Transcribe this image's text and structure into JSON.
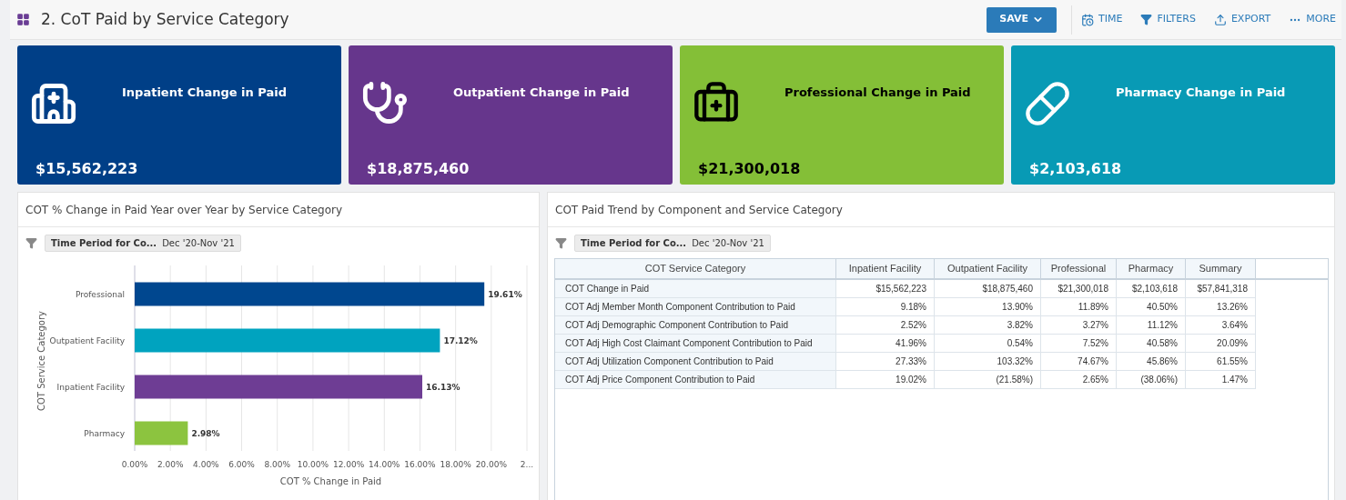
{
  "header": {
    "title": "2. CoT Paid by Service Category",
    "save_button": "SAVE",
    "toolbar": [
      {
        "label": "TIME",
        "kind": "time"
      },
      {
        "label": "FILTERS",
        "kind": "filters"
      },
      {
        "label": "EXPORT",
        "kind": "export"
      },
      {
        "label": "MORE",
        "kind": "more"
      }
    ]
  },
  "tiles": [
    {
      "title": "Inpatient Change in Paid",
      "value": "$15,562,223",
      "color": "#003f87"
    },
    {
      "title": "Outpatient Change in Paid",
      "value": "$18,875,460",
      "color": "#66368c"
    },
    {
      "title": "Professional Change in Paid",
      "value": "$21,300,018",
      "color": "#84bf37"
    },
    {
      "title": "Pharmacy Change in Paid",
      "value": "$2,103,618",
      "color": "#089ab5"
    }
  ],
  "left_panel": {
    "title": "COT % Change in Paid Year over Year by Service Category",
    "filter": {
      "label": "Time Period for Co...",
      "value": "Dec '20-Nov '21"
    },
    "chart_data": {
      "type": "bar",
      "orientation": "horizontal",
      "xlabel": "COT % Change in Paid",
      "ylabel": "COT Service Category",
      "categories": [
        "Professional",
        "Outpatient Facility",
        "Inpatient Facility",
        "Pharmacy"
      ],
      "series": [
        {
          "values": [
            19.61,
            17.12,
            16.13,
            2.98
          ]
        }
      ],
      "grid": true,
      "colors": [
        "#00478f",
        "#00a3bf",
        "#6e3d94",
        "#8cc43f"
      ],
      "value_labels": [
        "19.61%",
        "17.12%",
        "16.13%",
        "2.98%"
      ],
      "xlim": [
        0,
        22
      ],
      "xticks": [
        {
          "value": 0,
          "label": "0.00%"
        },
        {
          "value": 2,
          "label": "2.00%"
        },
        {
          "value": 4,
          "label": "4.00%"
        },
        {
          "value": 6,
          "label": "6.00%"
        },
        {
          "value": 8,
          "label": "8.00%"
        },
        {
          "value": 10,
          "label": "10.00%"
        },
        {
          "value": 12,
          "label": "12.00%"
        },
        {
          "value": 14,
          "label": "14.00%"
        },
        {
          "value": 16,
          "label": "16.00%"
        },
        {
          "value": 18,
          "label": "18.00%"
        },
        {
          "value": 20,
          "label": "20.00%"
        },
        {
          "value": 22,
          "label": "2..."
        }
      ]
    }
  },
  "right_panel": {
    "title": "COT Paid Trend by Component and Service Category",
    "filter": {
      "label": "Time Period for Co...",
      "value": "Dec '20-Nov '21"
    },
    "table": {
      "columns": [
        "COT Service Category",
        "Inpatient Facility",
        "Outpatient Facility",
        "Professional",
        "Pharmacy",
        "Summary"
      ],
      "rows": [
        [
          "COT Change in Paid",
          "$15,562,223",
          "$18,875,460",
          "$21,300,018",
          "$2,103,618",
          "$57,841,318"
        ],
        [
          "COT Adj Member Month Component Contribution to Paid",
          "9.18%",
          "13.90%",
          "11.89%",
          "40.50%",
          "13.26%"
        ],
        [
          "COT Adj Demographic Component Contribution to Paid",
          "2.52%",
          "3.82%",
          "3.27%",
          "11.12%",
          "3.64%"
        ],
        [
          "COT Adj High Cost Claimant Component Contribution to Paid",
          "41.96%",
          "0.54%",
          "7.52%",
          "40.58%",
          "20.09%"
        ],
        [
          "COT Adj Utilization Component Contribution to Paid",
          "27.33%",
          "103.32%",
          "74.67%",
          "45.86%",
          "61.55%"
        ],
        [
          "COT Adj Price Component Contribution to Paid",
          "19.02%",
          "(21.58%)",
          "2.65%",
          "(38.06%)",
          "1.47%"
        ]
      ]
    }
  }
}
